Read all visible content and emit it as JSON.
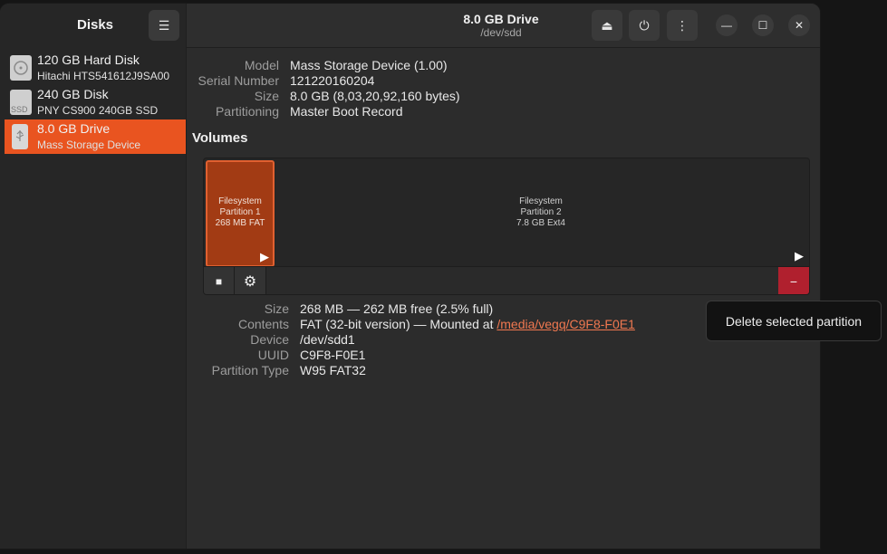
{
  "app": {
    "title": "Disks"
  },
  "header": {
    "drive_title": "8.0 GB Drive",
    "drive_path": "/dev/sdd",
    "icons": [
      "menu-icon",
      "eject-icon",
      "power-icon",
      "more-options-icon",
      "minimize-icon",
      "maximize-icon",
      "close-icon"
    ]
  },
  "sidebar": {
    "items": [
      {
        "name": "120 GB Hard Disk",
        "model": "Hitachi HTS541612J9SA00",
        "icon": "hard-disk-icon",
        "selected": false
      },
      {
        "name": "240 GB Disk",
        "model": "PNY CS900 240GB SSD",
        "icon": "ssd-icon",
        "icon_text": "SSD",
        "selected": false
      },
      {
        "name": "8.0 GB Drive",
        "model": "Mass Storage Device",
        "icon": "usb-drive-icon",
        "selected": true
      }
    ]
  },
  "drive": {
    "labels": {
      "model": "Model",
      "serial": "Serial Number",
      "size": "Size",
      "partitioning": "Partitioning"
    },
    "values": {
      "model": "Mass Storage Device (1.00)",
      "serial": "121220160204",
      "size": "8.0 GB (8,03,20,92,160 bytes)",
      "partitioning": "Master Boot Record"
    }
  },
  "volumes": {
    "heading": "Volumes",
    "partitions": [
      {
        "line1": "Filesystem",
        "line2": "Partition 1",
        "line3": "268 MB FAT",
        "selected": true
      },
      {
        "line1": "Filesystem",
        "line2": "Partition 2",
        "line3": "7.8 GB Ext4",
        "selected": false
      }
    ]
  },
  "partition": {
    "labels": {
      "size": "Size",
      "contents": "Contents",
      "device": "Device",
      "uuid": "UUID",
      "type": "Partition Type"
    },
    "values": {
      "size": "268 MB — 262 MB free (2.5% full)",
      "contents_prefix": "FAT (32-bit version) — Mounted at ",
      "mount_link": "/media/vegq/C9F8-F0E1",
      "device": "/dev/sdd1",
      "uuid": "C9F8-F0E1",
      "type": "W95 FAT32"
    }
  },
  "tooltip": {
    "text": "Delete selected partition"
  },
  "colors": {
    "accent": "#e95420",
    "delete": "#b0202e",
    "link": "#f07850"
  }
}
